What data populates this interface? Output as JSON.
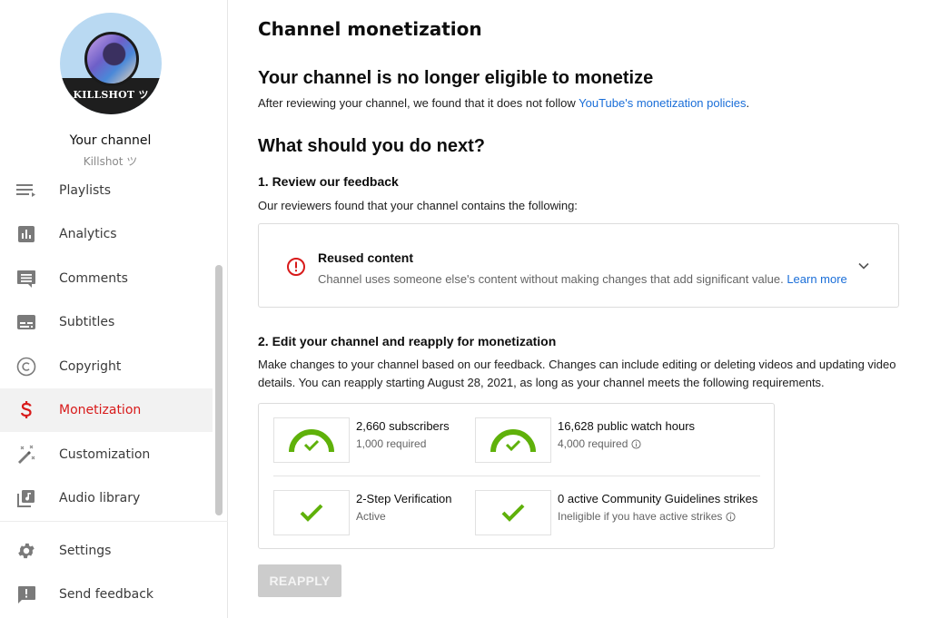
{
  "sidebar": {
    "avatar_text": "KILLSHOT ツ",
    "your_channel_label": "Your channel",
    "channel_name": "Killshot ツ",
    "items": [
      {
        "label": "Playlists",
        "icon": "playlist-icon"
      },
      {
        "label": "Analytics",
        "icon": "analytics-icon"
      },
      {
        "label": "Comments",
        "icon": "comments-icon"
      },
      {
        "label": "Subtitles",
        "icon": "subtitles-icon"
      },
      {
        "label": "Copyright",
        "icon": "copyright-icon"
      },
      {
        "label": "Monetization",
        "icon": "dollar-icon",
        "active": true
      },
      {
        "label": "Customization",
        "icon": "magic-wand-icon"
      },
      {
        "label": "Audio library",
        "icon": "audio-library-icon"
      }
    ],
    "footer_items": [
      {
        "label": "Settings",
        "icon": "gear-icon"
      },
      {
        "label": "Send feedback",
        "icon": "feedback-icon"
      }
    ]
  },
  "main": {
    "page_title": "Channel monetization",
    "ineligible_heading": "Your channel is no longer eligible to monetize",
    "ineligible_text": "After reviewing your channel, we found that it does not follow ",
    "policies_link": "YouTube's monetization policies",
    "ineligible_text_end": ".",
    "next_heading": "What should you do next?",
    "step1": {
      "heading": "1. Review our feedback",
      "text": "Our reviewers found that your channel contains the following:",
      "feedback": {
        "title": "Reused content",
        "description": "Channel uses someone else's content without making changes that add significant value. ",
        "learn_more": "Learn more"
      }
    },
    "step2": {
      "heading": "2. Edit your channel and reapply for monetization",
      "text": "Make changes to your channel based on our feedback. Changes can include editing or deleting videos and updating video details. You can reapply starting August 28, 2021, as long as your channel meets the following requirements."
    },
    "requirements": [
      {
        "title": "2,660 subscribers",
        "subtitle": "1,000 required",
        "type": "gauge",
        "progress": 1.0,
        "info": false
      },
      {
        "title": "16,628 public watch hours",
        "subtitle": "4,000 required",
        "type": "gauge",
        "progress": 1.0,
        "info": true
      },
      {
        "title": "2-Step Verification",
        "subtitle": "Active",
        "type": "check",
        "info": false
      },
      {
        "title": "0 active Community Guidelines strikes",
        "subtitle": "Ineligible if you have active strikes",
        "type": "check",
        "info": true
      }
    ],
    "reapply_button": "REAPPLY"
  },
  "colors": {
    "accent_red": "#d81a1a",
    "link_blue": "#1a6ed8",
    "success_green": "#5fb10a",
    "disabled_button": "#cccccc"
  }
}
